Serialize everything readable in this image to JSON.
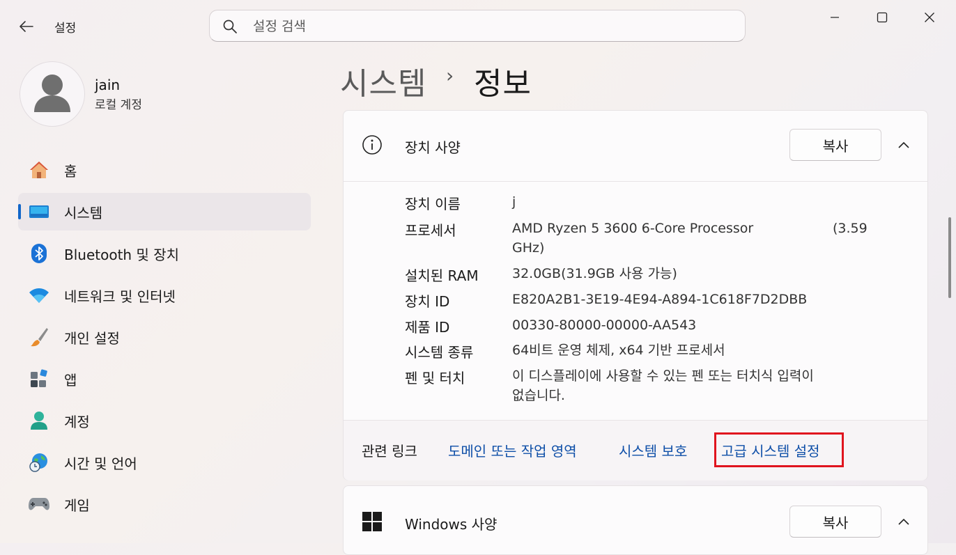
{
  "window": {
    "title": "설정",
    "controls": {
      "minimize": "minimize-icon",
      "maximize": "maximize-icon",
      "close": "close-icon"
    }
  },
  "search": {
    "placeholder": "설정 검색",
    "value": ""
  },
  "profile": {
    "name": "jain",
    "account_type": "로컬 계정"
  },
  "sidebar": {
    "items": [
      {
        "label": "홈",
        "icon": "home-icon",
        "active": false
      },
      {
        "label": "시스템",
        "icon": "system-icon",
        "active": true
      },
      {
        "label": "Bluetooth 및 장치",
        "icon": "bluetooth-icon",
        "active": false
      },
      {
        "label": "네트워크 및 인터넷",
        "icon": "wifi-icon",
        "active": false
      },
      {
        "label": "개인 설정",
        "icon": "brush-icon",
        "active": false
      },
      {
        "label": "앱",
        "icon": "apps-icon",
        "active": false
      },
      {
        "label": "계정",
        "icon": "person-icon",
        "active": false
      },
      {
        "label": "시간 및 언어",
        "icon": "globe-clock-icon",
        "active": false
      },
      {
        "label": "게임",
        "icon": "gamepad-icon",
        "active": false
      }
    ]
  },
  "breadcrumb": {
    "parent": "시스템",
    "separator": "›",
    "current": "정보"
  },
  "device_specs": {
    "title": "장치 사양",
    "copy_label": "복사",
    "rows": [
      {
        "label": "장치 이름",
        "value": "j"
      },
      {
        "label": "프로세서",
        "value": "AMD Ryzen 5 3600 6-Core Processor",
        "value_suffix": "(3.59",
        "value_line2": "GHz)"
      },
      {
        "label": "설치된 RAM",
        "value": "32.0GB(31.9GB 사용 가능)"
      },
      {
        "label": "장치 ID",
        "value": "E820A2B1-3E19-4E94-A894-1C618F7D2DBB"
      },
      {
        "label": "제품 ID",
        "value": "00330-80000-00000-AA543"
      },
      {
        "label": "시스템 종류",
        "value": "64비트 운영 체제, x64 기반 프로세서"
      },
      {
        "label": "펜 및 터치",
        "value": "이 디스플레이에 사용할 수 있는 펜 또는 터치식 입력이",
        "value_line2": "없습니다."
      }
    ],
    "related": {
      "label": "관련 링크",
      "links": [
        "도메인 또는 작업 영역",
        "시스템 보호",
        "고급 시스템 설정"
      ]
    }
  },
  "windows_specs": {
    "title": "Windows 사양",
    "copy_label": "복사"
  },
  "colors": {
    "accent": "#1166c9",
    "link": "#0f4fa8",
    "highlight": "#e0141e"
  }
}
